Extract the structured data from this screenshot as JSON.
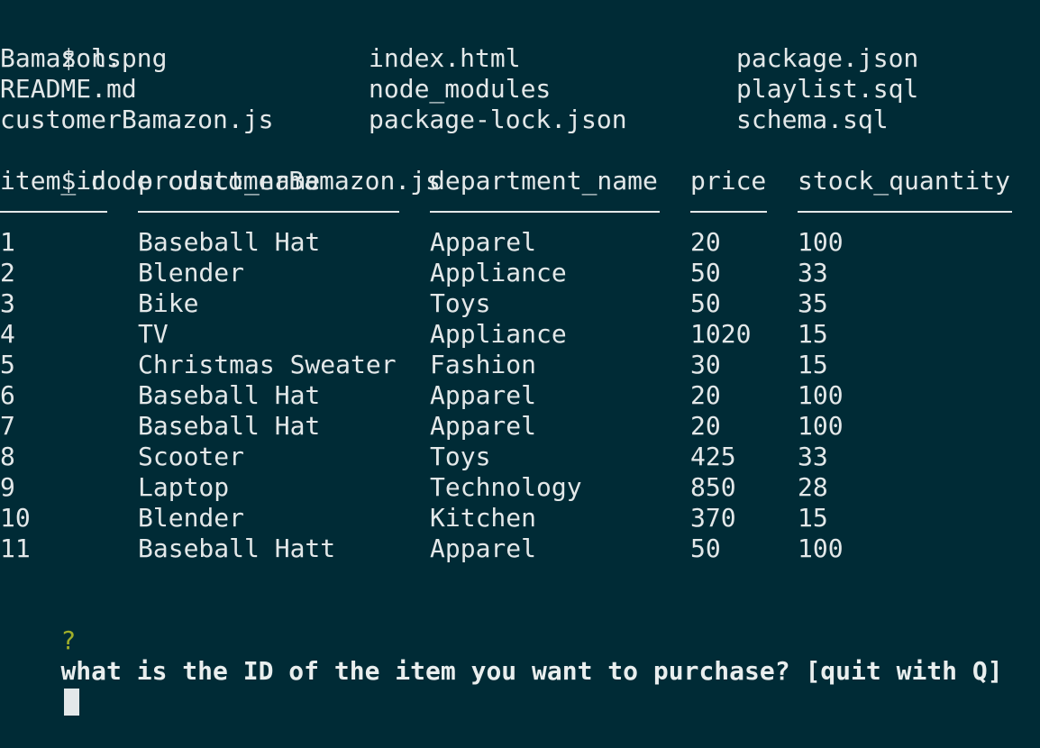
{
  "commands": {
    "ls": "$ ls",
    "node": "$ node customerBamazon.js"
  },
  "ls_output": [
    [
      "Bamazon.png",
      "index.html",
      "package.json"
    ],
    [
      "README.md",
      "node_modules",
      "playlist.sql"
    ],
    [
      "customerBamazon.js",
      "package-lock.json",
      "schema.sql"
    ]
  ],
  "table": {
    "headers": [
      "item_id",
      "product_name",
      "department_name",
      "price",
      "stock_quantity"
    ],
    "rows": [
      [
        "1",
        "Baseball Hat",
        "Apparel",
        "20",
        "100"
      ],
      [
        "2",
        "Blender",
        "Appliance",
        "50",
        "33"
      ],
      [
        "3",
        "Bike",
        "Toys",
        "50",
        "35"
      ],
      [
        "4",
        "TV",
        "Appliance",
        "1020",
        "15"
      ],
      [
        "5",
        "Christmas Sweater",
        "Fashion",
        "30",
        "15"
      ],
      [
        "6",
        "Baseball Hat",
        "Apparel",
        "20",
        "100"
      ],
      [
        "7",
        "Baseball Hat",
        "Apparel",
        "20",
        "100"
      ],
      [
        "8",
        "Scooter",
        "Toys",
        "425",
        "33"
      ],
      [
        "9",
        "Laptop",
        "Technology",
        "850",
        "28"
      ],
      [
        "10",
        "Blender",
        "Kitchen",
        "370",
        "15"
      ],
      [
        "11",
        "Baseball Hatt",
        "Apparel",
        "50",
        "100"
      ]
    ]
  },
  "prompt": {
    "marker": "?",
    "question": "what is the ID of the item you want to purchase? [quit with Q]"
  },
  "colors": {
    "background": "#002b36",
    "text": "#e3e8e9",
    "question_mark": "#9fae2a"
  }
}
